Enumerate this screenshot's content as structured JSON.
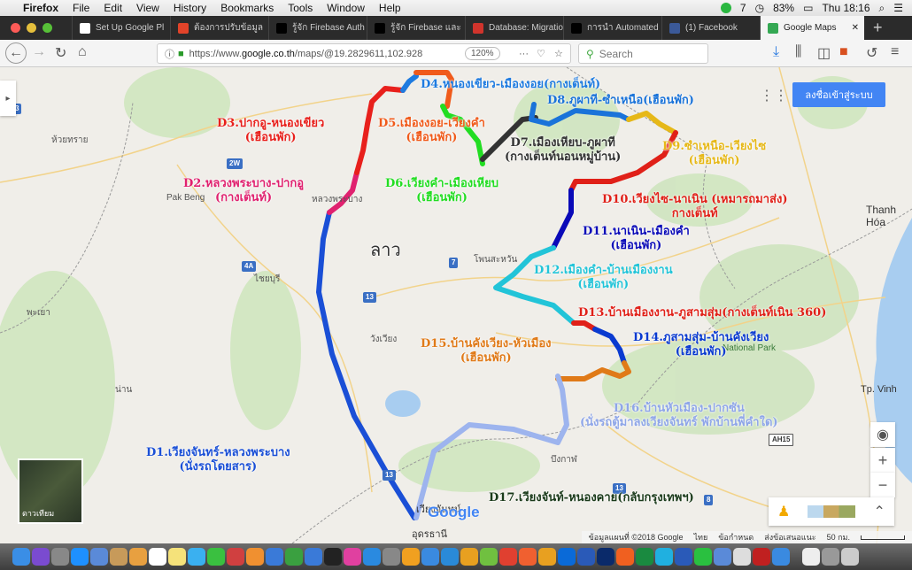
{
  "menubar": {
    "app": "Firefox",
    "items": [
      "File",
      "Edit",
      "View",
      "History",
      "Bookmarks",
      "Tools",
      "Window",
      "Help"
    ],
    "battery": "83%",
    "clock": "Thu 18:16",
    "status_number": "7"
  },
  "tabs": [
    {
      "label": "Set Up Google Pl",
      "color": "#ffffff"
    },
    {
      "label": "ต้องการปรับข้อมูล",
      "color": "#e24329"
    },
    {
      "label": "รู้จัก Firebase Auth",
      "color": "#000000"
    },
    {
      "label": "รู้จัก Firebase และ",
      "color": "#000000"
    },
    {
      "label": "Database: Migratio",
      "color": "#d0342c"
    },
    {
      "label": "การนำ Automated",
      "color": "#000000"
    },
    {
      "label": "(1) Facebook",
      "color": "#3b5998"
    },
    {
      "label": "Google Maps",
      "color": "#34a853",
      "active": true
    }
  ],
  "navbar": {
    "url_prefix": "https://www.",
    "url_domain": "google.co.th",
    "url_rest": "/maps/@19.2829611,102.928",
    "zoom": "120%",
    "search_placeholder": "Search"
  },
  "map": {
    "login_button": "ลงชื่อเข้าสู่ระบบ",
    "satellite_label": "ดาวเทียม",
    "country_label": "ลาว",
    "places": [
      "Pak Beng",
      "หลวงพระบาง",
      "ไชยบุรี",
      "พะเยา",
      "น่าน",
      "วังเวียง",
      "โพนสะหวัน",
      "Thanh Hóa",
      "Tp. Vinh",
      "National Park",
      "บึงกาฬ",
      "อุดรธานี",
      "เวียงจันทน์",
      "ห้วยทราย"
    ],
    "routes": [
      {
        "id": "D1",
        "text": "D1.เวียงจันทร์-หลวงพระบาง",
        "sub": "(นั่งรถโดยสาร)",
        "color": "#1a4fd6"
      },
      {
        "id": "D2",
        "text": "D2.หลวงพระบาง-ปากอู",
        "sub": "(กางเต็นท์)",
        "color": "#e0216f"
      },
      {
        "id": "D3",
        "text": "D3.ปากอู-หนองเขียว",
        "sub": "(เฮือนพัก)",
        "color": "#e8201c"
      },
      {
        "id": "D4",
        "text": "D4.หนองเขียว-เมืองงอย(กางเต็นท์)",
        "sub": "",
        "color": "#1e7be0"
      },
      {
        "id": "D5",
        "text": "D5.เมืองงอย-เวียงคำ",
        "sub": "(เฮือนพัก)",
        "color": "#f05a1a"
      },
      {
        "id": "D6",
        "text": "D6.เวียงคำ-เมืองเหียบ",
        "sub": "(เฮือนพัก)",
        "color": "#22dd22"
      },
      {
        "id": "D7",
        "text": "D7.เมืองเหียบ-ภูผาที",
        "sub": "(กางเต็นท์นอนหมู่บ้าน)",
        "color": "#333333"
      },
      {
        "id": "D8",
        "text": "D8.ภูผาที-ซำเหนือ(เฮือนพัก)",
        "sub": "",
        "color": "#1a73d9"
      },
      {
        "id": "D9",
        "text": "D9.ซำเหนือ-เวียงไซ",
        "sub": "(เฮือนพัก)",
        "color": "#e6b818"
      },
      {
        "id": "D10",
        "text": "D10.เวียงไซ-นาเนิน (เหมารถมาส่ง)",
        "sub": "กางเต็นท์",
        "color": "#e02018"
      },
      {
        "id": "D11",
        "text": "D11.นาเนิน-เมืองคำ",
        "sub": "(เฮือนพัก)",
        "color": "#0a0ab8"
      },
      {
        "id": "D12",
        "text": "D12.เมืองคำ-บ้านเมืองงาน",
        "sub": "(เฮือนพัก)",
        "color": "#22c4d8"
      },
      {
        "id": "D13",
        "text": "D13.บ้านเมืองงาน-ภูสามสุ่ม(กางเต็นท์เนิน 360)",
        "sub": "",
        "color": "#e02018"
      },
      {
        "id": "D14",
        "text": "D14.ภูสามสุ่ม-บ้านคังเวียง",
        "sub": "(เฮือนพัก)",
        "color": "#0a3ad0"
      },
      {
        "id": "D15",
        "text": "D15.บ้านคังเวียง-หัวเมือง",
        "sub": "(เฮือนพัก)",
        "color": "#e07a18"
      },
      {
        "id": "D16",
        "text": "D16.บ้านหัวเมือง-ปากซัน",
        "sub": "(นั่งรถตู้มาลงเวียงจันทร์ พักบ้านพี่คำใด)",
        "color": "#9db4ee"
      },
      {
        "id": "D17",
        "text": "D17.เวียงจันท์-หนองคาย(กลับกรุงเทพฯ)",
        "sub": "",
        "color": "#1a3a1a"
      }
    ],
    "footer": {
      "attribution": "ข้อมูลแผนที่ ©2018 Google",
      "lang": "ไทย",
      "terms": "ข้อกำหนด",
      "feedback": "ส่งข้อเสนอแนะ",
      "scale": "50 กม."
    },
    "google_logo": "Google",
    "road_shields": [
      "3",
      "2W",
      "4A",
      "13",
      "7",
      "13",
      "13",
      "8",
      "AH15"
    ]
  },
  "dock": {
    "icons": [
      "finder",
      "siri",
      "launchpad",
      "safari",
      "preview",
      "contacts",
      "photos",
      "calendar",
      "notes",
      "messages",
      "facetime",
      "photo-booth",
      "pages",
      "xcode",
      "numbers",
      "keynote",
      "terminal",
      "itunes",
      "app-store",
      "system-preferences",
      "sublime",
      "chrome-canary",
      "teamviewer",
      "sketch",
      "android-studio",
      "chrome",
      "swift",
      "sequel",
      "teamviewer",
      "vscode",
      "photoshop",
      "firefox",
      "excel",
      "skype",
      "word",
      "line",
      "vpn",
      "file",
      "filezilla",
      "quicktime",
      "doc",
      "help",
      "trash"
    ],
    "colors": [
      "#3a8ee6",
      "#7a4bd0",
      "#888",
      "#1e90ff",
      "#5a8ad8",
      "#c79a5a",
      "#e8a040",
      "#fff",
      "#f5e27a",
      "#3ab0f0",
      "#3ac040",
      "#d04040",
      "#f09030",
      "#3a7ad8",
      "#3aa040",
      "#3a7ad8",
      "#222",
      "#e040a0",
      "#2a8ae0",
      "#888",
      "#f0a020",
      "#3a8ae0",
      "#2a8ad8",
      "#e8a020",
      "#70c040",
      "#e04030",
      "#f06030",
      "#e8a020",
      "#0a6ad8",
      "#2a5ab8",
      "#0a2a6a",
      "#f06020",
      "#1a8a40",
      "#20b0e0",
      "#2a5ab8",
      "#2ac040",
      "#5a8ad8",
      "#ddd",
      "#c02020",
      "#3a8ae0",
      "#eee",
      "#999",
      "#ccc"
    ]
  }
}
